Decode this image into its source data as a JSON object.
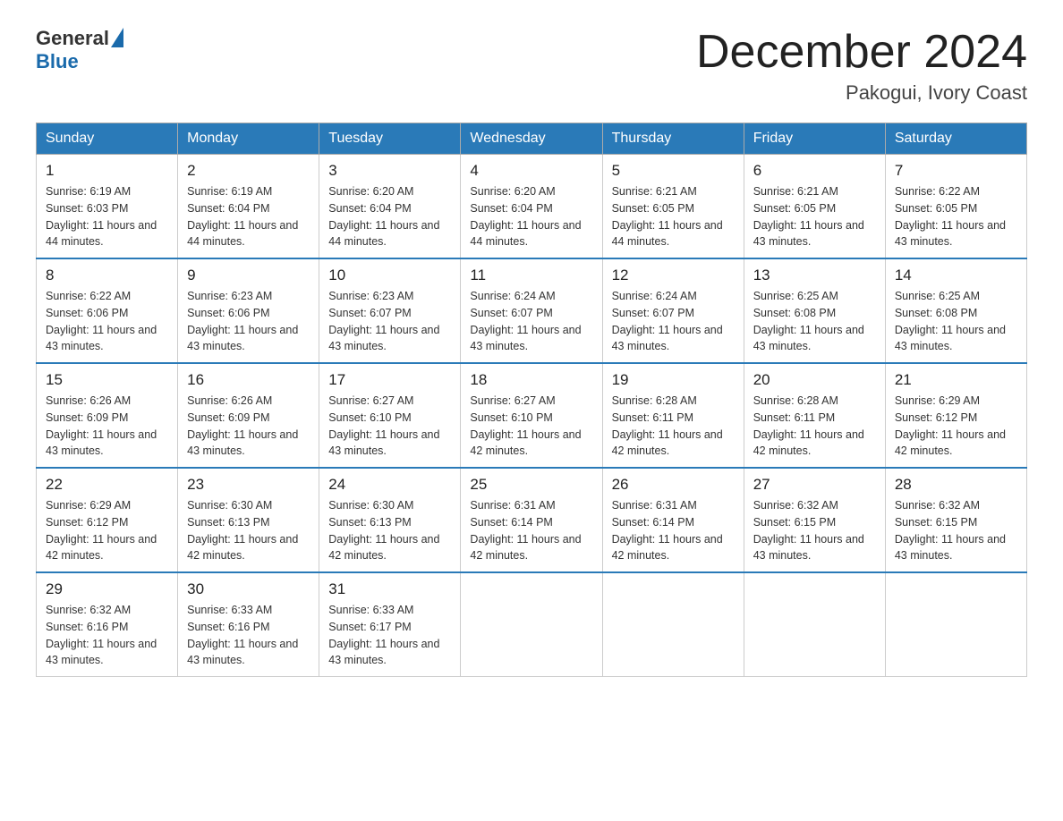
{
  "header": {
    "logo_general": "General",
    "logo_blue": "Blue",
    "month_title": "December 2024",
    "location": "Pakogui, Ivory Coast"
  },
  "days_of_week": [
    "Sunday",
    "Monday",
    "Tuesday",
    "Wednesday",
    "Thursday",
    "Friday",
    "Saturday"
  ],
  "weeks": [
    [
      {
        "day": "1",
        "sunrise": "6:19 AM",
        "sunset": "6:03 PM",
        "daylight": "11 hours and 44 minutes."
      },
      {
        "day": "2",
        "sunrise": "6:19 AM",
        "sunset": "6:04 PM",
        "daylight": "11 hours and 44 minutes."
      },
      {
        "day": "3",
        "sunrise": "6:20 AM",
        "sunset": "6:04 PM",
        "daylight": "11 hours and 44 minutes."
      },
      {
        "day": "4",
        "sunrise": "6:20 AM",
        "sunset": "6:04 PM",
        "daylight": "11 hours and 44 minutes."
      },
      {
        "day": "5",
        "sunrise": "6:21 AM",
        "sunset": "6:05 PM",
        "daylight": "11 hours and 44 minutes."
      },
      {
        "day": "6",
        "sunrise": "6:21 AM",
        "sunset": "6:05 PM",
        "daylight": "11 hours and 43 minutes."
      },
      {
        "day": "7",
        "sunrise": "6:22 AM",
        "sunset": "6:05 PM",
        "daylight": "11 hours and 43 minutes."
      }
    ],
    [
      {
        "day": "8",
        "sunrise": "6:22 AM",
        "sunset": "6:06 PM",
        "daylight": "11 hours and 43 minutes."
      },
      {
        "day": "9",
        "sunrise": "6:23 AM",
        "sunset": "6:06 PM",
        "daylight": "11 hours and 43 minutes."
      },
      {
        "day": "10",
        "sunrise": "6:23 AM",
        "sunset": "6:07 PM",
        "daylight": "11 hours and 43 minutes."
      },
      {
        "day": "11",
        "sunrise": "6:24 AM",
        "sunset": "6:07 PM",
        "daylight": "11 hours and 43 minutes."
      },
      {
        "day": "12",
        "sunrise": "6:24 AM",
        "sunset": "6:07 PM",
        "daylight": "11 hours and 43 minutes."
      },
      {
        "day": "13",
        "sunrise": "6:25 AM",
        "sunset": "6:08 PM",
        "daylight": "11 hours and 43 minutes."
      },
      {
        "day": "14",
        "sunrise": "6:25 AM",
        "sunset": "6:08 PM",
        "daylight": "11 hours and 43 minutes."
      }
    ],
    [
      {
        "day": "15",
        "sunrise": "6:26 AM",
        "sunset": "6:09 PM",
        "daylight": "11 hours and 43 minutes."
      },
      {
        "day": "16",
        "sunrise": "6:26 AM",
        "sunset": "6:09 PM",
        "daylight": "11 hours and 43 minutes."
      },
      {
        "day": "17",
        "sunrise": "6:27 AM",
        "sunset": "6:10 PM",
        "daylight": "11 hours and 43 minutes."
      },
      {
        "day": "18",
        "sunrise": "6:27 AM",
        "sunset": "6:10 PM",
        "daylight": "11 hours and 42 minutes."
      },
      {
        "day": "19",
        "sunrise": "6:28 AM",
        "sunset": "6:11 PM",
        "daylight": "11 hours and 42 minutes."
      },
      {
        "day": "20",
        "sunrise": "6:28 AM",
        "sunset": "6:11 PM",
        "daylight": "11 hours and 42 minutes."
      },
      {
        "day": "21",
        "sunrise": "6:29 AM",
        "sunset": "6:12 PM",
        "daylight": "11 hours and 42 minutes."
      }
    ],
    [
      {
        "day": "22",
        "sunrise": "6:29 AM",
        "sunset": "6:12 PM",
        "daylight": "11 hours and 42 minutes."
      },
      {
        "day": "23",
        "sunrise": "6:30 AM",
        "sunset": "6:13 PM",
        "daylight": "11 hours and 42 minutes."
      },
      {
        "day": "24",
        "sunrise": "6:30 AM",
        "sunset": "6:13 PM",
        "daylight": "11 hours and 42 minutes."
      },
      {
        "day": "25",
        "sunrise": "6:31 AM",
        "sunset": "6:14 PM",
        "daylight": "11 hours and 42 minutes."
      },
      {
        "day": "26",
        "sunrise": "6:31 AM",
        "sunset": "6:14 PM",
        "daylight": "11 hours and 42 minutes."
      },
      {
        "day": "27",
        "sunrise": "6:32 AM",
        "sunset": "6:15 PM",
        "daylight": "11 hours and 43 minutes."
      },
      {
        "day": "28",
        "sunrise": "6:32 AM",
        "sunset": "6:15 PM",
        "daylight": "11 hours and 43 minutes."
      }
    ],
    [
      {
        "day": "29",
        "sunrise": "6:32 AM",
        "sunset": "6:16 PM",
        "daylight": "11 hours and 43 minutes."
      },
      {
        "day": "30",
        "sunrise": "6:33 AM",
        "sunset": "6:16 PM",
        "daylight": "11 hours and 43 minutes."
      },
      {
        "day": "31",
        "sunrise": "6:33 AM",
        "sunset": "6:17 PM",
        "daylight": "11 hours and 43 minutes."
      },
      null,
      null,
      null,
      null
    ]
  ]
}
